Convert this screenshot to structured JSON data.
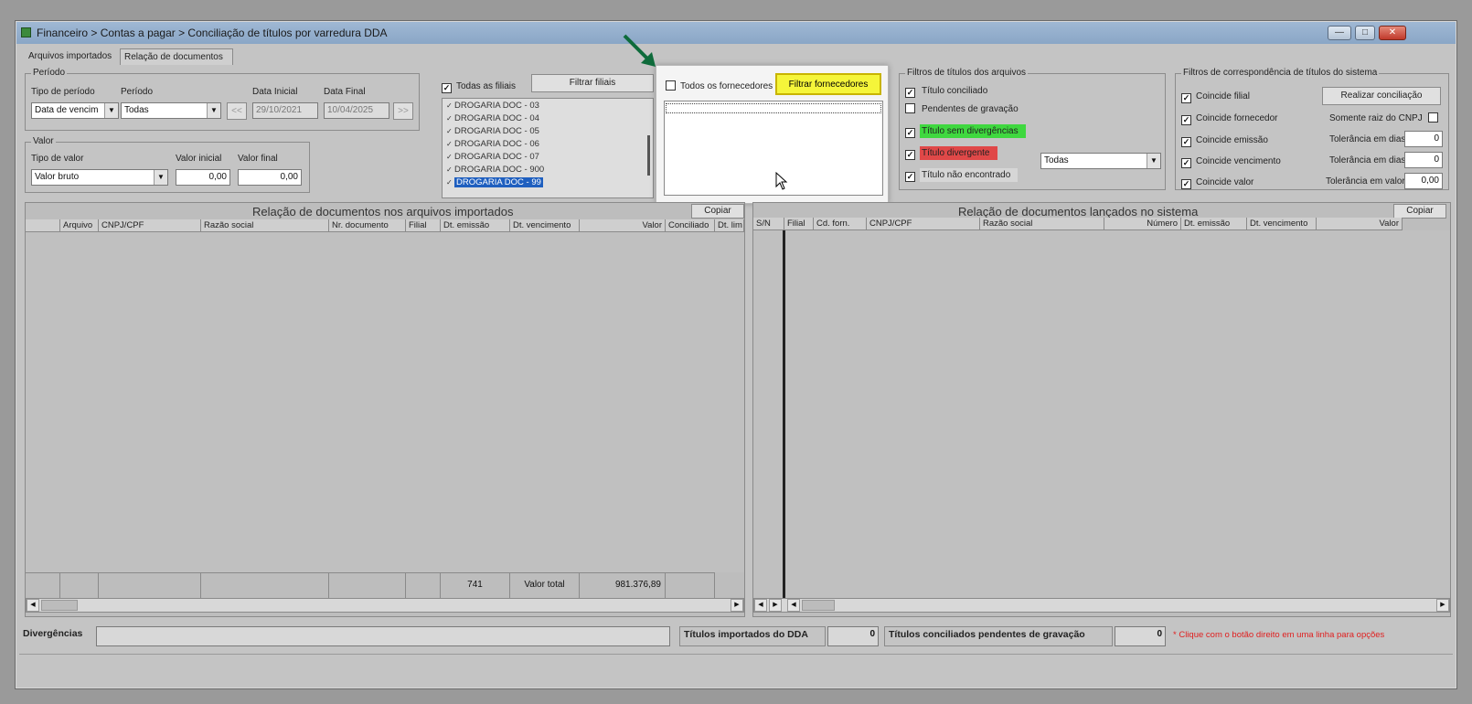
{
  "window": {
    "title": "Financeiro > Contas a pagar > Conciliação de títulos por varredura DDA",
    "tabs": [
      "Arquivos importados",
      "Relação de documentos"
    ],
    "active_tab": 1
  },
  "periodo": {
    "legend": "Período",
    "tipo_label": "Tipo de período",
    "tipo_value": "Data de vencim",
    "periodo_label": "Período",
    "periodo_value": "Todas",
    "prev_button": "<<",
    "next_button": ">>",
    "data_inicial_label": "Data Inicial",
    "data_inicial_value": "29/10/2021",
    "data_final_label": "Data Final",
    "data_final_value": "10/04/2025"
  },
  "valor": {
    "legend": "Valor",
    "tipo_label": "Tipo de valor",
    "tipo_value": "Valor bruto",
    "inicial_label": "Valor inicial",
    "inicial_value": "0,00",
    "final_label": "Valor final",
    "final_value": "0,00"
  },
  "filiais": {
    "todas_label": "Todas as filiais",
    "todas_checked": true,
    "filtrar_button": "Filtrar filiais",
    "items": [
      {
        "label": "DROGARIA DOC - 03",
        "selected": false
      },
      {
        "label": "DROGARIA DOC - 04",
        "selected": false
      },
      {
        "label": "DROGARIA DOC - 05",
        "selected": false
      },
      {
        "label": "DROGARIA DOC - 06",
        "selected": false
      },
      {
        "label": "DROGARIA DOC - 07",
        "selected": false
      },
      {
        "label": "DROGARIA DOC - 900",
        "selected": false
      },
      {
        "label": "DROGARIA DOC - 99",
        "selected": true
      }
    ]
  },
  "fornecedores": {
    "todos_label": "Todos os fornecedores",
    "todos_checked": false,
    "filtrar_button": "Filtrar fornecedores",
    "highlight_color": "#f5f53a"
  },
  "filtros_arquivos": {
    "legend": "Filtros de títulos dos arquivos",
    "items": [
      {
        "label": "Título conciliado",
        "checked": true,
        "color": ""
      },
      {
        "label": "Pendentes de gravação",
        "checked": false,
        "color": ""
      },
      {
        "label": "Título sem divergências",
        "checked": true,
        "color": "#3fd83f"
      },
      {
        "label": "Título divergente",
        "checked": true,
        "color": "#e04848"
      },
      {
        "label": "Título não encontrado",
        "checked": true,
        "color": "#d6d6d6"
      }
    ],
    "divergente_select": "Todas"
  },
  "filtros_sistema": {
    "legend": "Filtros de correspondência de títulos do sistema",
    "items": [
      {
        "label": "Coincide filial",
        "checked": true
      },
      {
        "label": "Coincide fornecedor",
        "checked": true
      },
      {
        "label": "Coincide emissão",
        "checked": true
      },
      {
        "label": "Coincide vencimento",
        "checked": true
      },
      {
        "label": "Coincide valor",
        "checked": true
      }
    ],
    "realizar_button": "Realizar conciliação",
    "somente_raiz_label": "Somente raiz do CNPJ",
    "tol_emissao_label": "Tolerância em dias",
    "tol_emissao_value": "0",
    "tol_vencimento_label": "Tolerância em dias",
    "tol_vencimento_value": "0",
    "tol_valor_label": "Tolerância em valor",
    "tol_valor_value": "0,00"
  },
  "grid_arquivos": {
    "title": "Relação de documentos nos arquivos importados",
    "copy_button": "Copiar",
    "columns": [
      "",
      "Arquivo",
      "CNPJ/CPF",
      "Razão social",
      "Nr. documento",
      "Filial",
      "Dt. emissão",
      "Dt. vencimento",
      "Valor",
      "Conciliado",
      "Dt. lim"
    ],
    "totals": {
      "count": "741",
      "label": "Valor total",
      "value": "981.376,89"
    }
  },
  "grid_sistema": {
    "title": "Relação de documentos lançados no sistema",
    "copy_button": "Copiar",
    "columns": [
      "S/N",
      "Filial",
      "Cd. forn.",
      "CNPJ/CPF",
      "Razão social",
      "Número",
      "Dt. emissão",
      "Dt. vencimento",
      "Valor"
    ]
  },
  "status": {
    "divergencias_label": "Divergências",
    "divergencias_value": "",
    "importados_label": "Títulos importados do DDA",
    "importados_value": "0",
    "pendentes_label": "Títulos conciliados pendentes de gravação",
    "pendentes_value": "0",
    "hint": "* Clique com o botão direito em uma linha para opções",
    "hint_color": "#e02020"
  }
}
